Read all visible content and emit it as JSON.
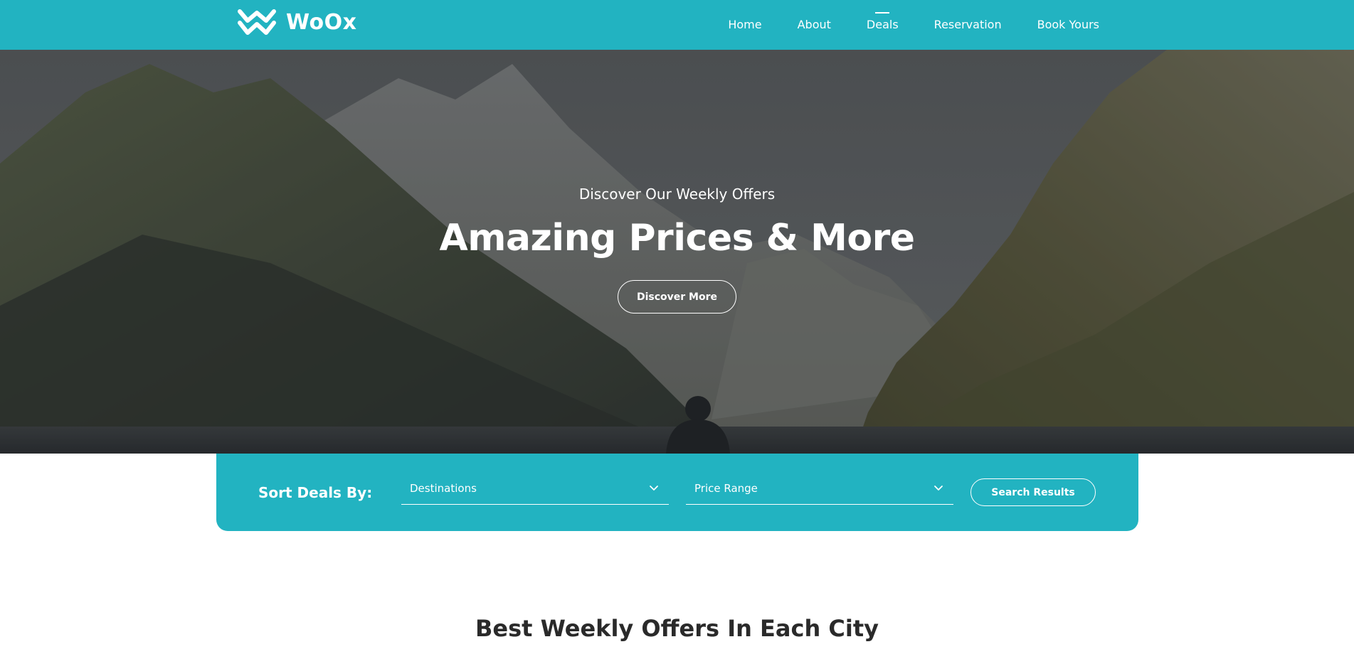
{
  "brand": {
    "name": "WoOx",
    "accent_color": "#22b3c1",
    "logo_icon": "double-chevron-w-icon"
  },
  "nav": {
    "items": [
      {
        "label": "Home"
      },
      {
        "label": "About"
      },
      {
        "label": "Deals",
        "active": true
      },
      {
        "label": "Reservation"
      },
      {
        "label": "Book Yours"
      }
    ]
  },
  "hero": {
    "subtitle": "Discover Our Weekly Offers",
    "title": "Amazing Prices & More",
    "button_label": "Discover More"
  },
  "search": {
    "sort_label": "Sort Deals By:",
    "destination_select": {
      "value": "Destinations",
      "icon": "chevron-down-icon"
    },
    "price_select": {
      "value": "Price Range",
      "icon": "chevron-down-icon"
    },
    "button_label": "Search Results"
  },
  "offers": {
    "title": "Best Weekly Offers In Each City"
  }
}
